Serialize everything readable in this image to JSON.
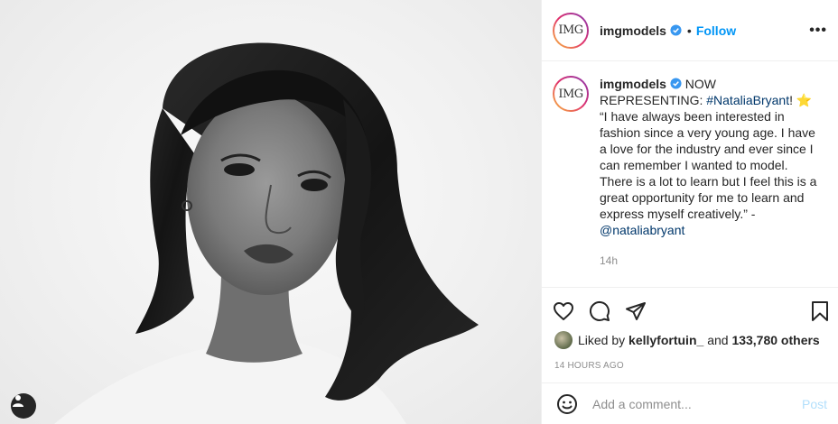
{
  "post": {
    "username": "imgmodels",
    "avatar_text": "IMG",
    "dot": "•",
    "follow_label": "Follow",
    "more_label": "•••",
    "caption": {
      "username": "imgmodels",
      "lead": "NOW REPRESENTING:",
      "hashtag": "#NataliaBryant",
      "hashtag_suffix": "!",
      "star": "⭐",
      "body": " “I have always been interested in fashion since a very young age. I have a love for the industry and ever since I can remember I wanted to model. There is a lot to learn but I feel this is a great opportunity for me to learn and express myself creatively.” -",
      "mention": "@nataliabryant"
    },
    "time": "14h",
    "likes": {
      "prefix": "Liked by",
      "user": "kellyfortuin_",
      "middle": "and",
      "count": "133,780 others"
    },
    "posted_ago": "14 HOURS AGO",
    "comment": {
      "placeholder": "Add a comment...",
      "post_label": "Post"
    }
  },
  "colors": {
    "accent": "#0095f6",
    "link": "#00376b",
    "muted": "#8e8e8e",
    "post_disabled": "#b2dffc",
    "verified": "#3897f0"
  },
  "icons": [
    "heart-icon",
    "comment-icon",
    "share-icon",
    "save-icon",
    "emoji-icon",
    "user-tag-icon",
    "verified-badge-icon",
    "more-options-icon"
  ]
}
